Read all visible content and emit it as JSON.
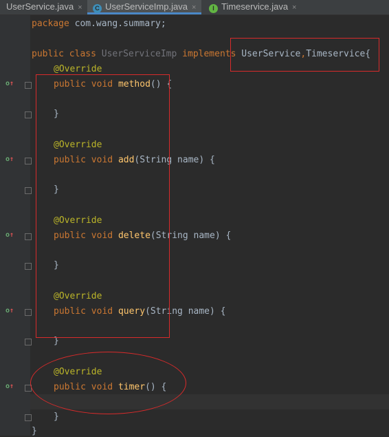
{
  "tabs": [
    {
      "label": "UserService.java",
      "icon": "interface-icon",
      "active": false
    },
    {
      "label": "UserServiceImp.java",
      "icon": "class-icon",
      "active": true
    },
    {
      "label": "Timeservice.java",
      "icon": "interface-icon",
      "active": false
    }
  ],
  "tab_icon_letters": {
    "class": "C",
    "interface": "I"
  },
  "close_glyph": "×",
  "code": {
    "package_kw": "package",
    "package_name": " com.wang.summary;",
    "public_kw": "public",
    "class_kw": "class",
    "class_name": "UserServiceImp",
    "implements_kw": "implements",
    "interface_1": "UserService",
    "comma": ",",
    "interface_2": "Timeservice",
    "open_brace": "{",
    "override": "@Override",
    "void_kw": "void",
    "close_brace": "}",
    "methods": [
      {
        "name": "method",
        "params": "() {"
      },
      {
        "name": "add",
        "params": "(String name) {"
      },
      {
        "name": "delete",
        "params": "(String name) {"
      },
      {
        "name": "query",
        "params": "(String name) {"
      },
      {
        "name": "timer",
        "params": "() {"
      }
    ]
  },
  "colors": {
    "keyword": "#cc7832",
    "annotation": "#bbb529",
    "method": "#ffc66d",
    "plain": "#a9b7c6",
    "highlight": "#d92b2b",
    "tab_underline": "#4a88c7"
  }
}
